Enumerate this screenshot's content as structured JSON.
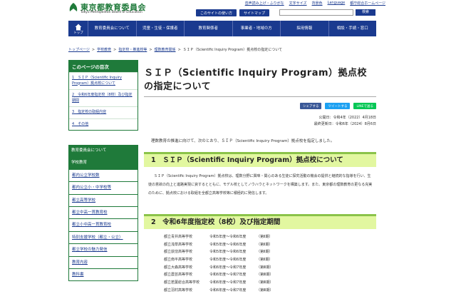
{
  "header": {
    "logo_title": "東京都教育委員会",
    "logo_sub": "Tokyo Metropolitan Board of Education",
    "util_links": [
      "音声読み上げ・ふりがな",
      "文字サイズ",
      "背景色",
      "Language",
      "都庁総合ホームページ"
    ],
    "about_label": "このサイトの使い方",
    "sitemap_label": "サイトマップ",
    "search_placeholder": "",
    "search_label": "検索"
  },
  "gnav": {
    "home_label": "トップ",
    "items": [
      "教育委員会について",
      "児童・生徒・保護者",
      "教育関係者",
      "事業者・地域の方",
      "採用情報",
      "相談・手続・窓口"
    ]
  },
  "breadcrumb": {
    "items": [
      "トップページ",
      "学校教育",
      "指定校・推進校等",
      "理数教育関係"
    ],
    "current": "ＳＩＰ（Scientific Inquiry Program）拠点校の指定について"
  },
  "toc": {
    "title": "このページの目次",
    "items": [
      "1　ＳＩＰ（Scientific Inquiry Program）拠点校について",
      "2　令和6年度指定校（8校）及び指定期間",
      "3　指定校の取組内容",
      "4　その他"
    ]
  },
  "side_nav": {
    "items": [
      {
        "label": "教育委員会について",
        "kind": "main"
      },
      {
        "label": "学校教育",
        "kind": "main"
      },
      {
        "label": "都内公立学校数",
        "kind": "sub"
      },
      {
        "label": "都内公立小・中学校等",
        "kind": "sub"
      },
      {
        "label": "都立高等学校",
        "kind": "sub"
      },
      {
        "label": "都立中高一貫教育校",
        "kind": "sub"
      },
      {
        "label": "都立小中高一貫教育校",
        "kind": "sub"
      },
      {
        "label": "特別支援学校（都立・公立）",
        "kind": "sub"
      },
      {
        "label": "都立学校の魅力発信",
        "kind": "sub"
      },
      {
        "label": "教育内容",
        "kind": "sub"
      },
      {
        "label": "教科書",
        "kind": "sub"
      }
    ]
  },
  "main": {
    "title": "ＳＩＰ（Scientific Inquiry Program）拠点校の指定について",
    "share": {
      "facebook": "シェアする",
      "twitter": "ツイートする",
      "line": "LINEで送る"
    },
    "published": "公開日：令和4年（2022）4月18日",
    "updated": "最終更新日：令和6年（2024）8月6日",
    "lead": "理数教育の推進に向けて、次のとおり、ＳＩＰ（Scientific Inquiry Program）拠点校を指定しました。",
    "section1_title": "1　ＳＩＰ（Scientific Inquiry Program）拠点校について",
    "section1_body": "ＳＩＰ（Scientific Inquiry Program）拠点校は、理数分野に興味・関心のある生徒に探究活動の機会の提供と継続的な指導を行い、生徒の意欲の向上と進路実現に資するとともに、モデル校としてノウハウとネットワークを構築します。また、東京都の理数教育の更なる充実のために、拠点校における取組を全都立高等学校等に積極的に発信します。",
    "section2_title": "2　令和6年度指定校（8校）及び指定期間",
    "schools": [
      {
        "name": "都立青井高等学校",
        "period": "令和5年度～令和6年度",
        "term": "（第Ⅱ期）"
      },
      {
        "name": "都立浅草高等学校",
        "period": "令和5年度～令和6年度",
        "term": "（第Ⅱ期）"
      },
      {
        "name": "都立荻窪高等学校",
        "period": "令和5年度～令和6年度",
        "term": "（第Ⅱ期）"
      },
      {
        "name": "都立南平高等学校",
        "period": "令和5年度～令和6年度",
        "term": "（第Ⅱ期）"
      },
      {
        "name": "都立大森高等学校",
        "period": "令和6年度～令和7年度",
        "term": "（第Ⅲ期）"
      },
      {
        "name": "都立農芸高等学校",
        "period": "令和6年度～令和7年度",
        "term": "（第Ⅲ期）"
      },
      {
        "name": "都立若葉総合高等学校",
        "period": "令和6年度～令和7年度",
        "term": "（第Ⅲ期）"
      },
      {
        "name": "都立羽村高等学校",
        "period": "令和6年度～令和7年度",
        "term": "（第Ⅲ期）"
      }
    ]
  },
  "colors": {
    "brand_green": "#1f7a3a",
    "nav_blue": "#1a3a8f",
    "section_bg": "#e2f7a0",
    "section_border": "#8bc34a"
  }
}
